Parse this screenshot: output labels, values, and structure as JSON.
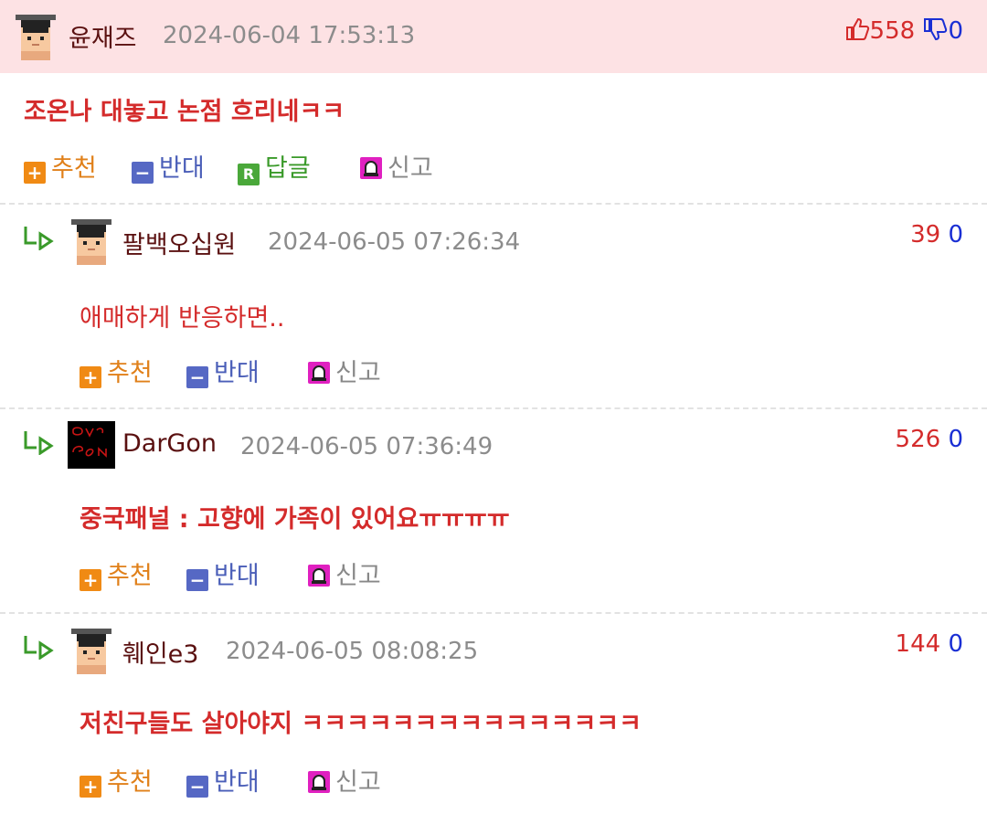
{
  "comments": [
    {
      "author": "윤재즈",
      "date": "2024-06-04 17:53:13",
      "up": "558",
      "down": "0",
      "content": "조온나 대놓고 논점 흐리네ㅋㅋ",
      "actions": {
        "recommend": "추천",
        "oppose": "반대",
        "reply": "답글",
        "report": "신고"
      }
    },
    {
      "author": "팔백오십원",
      "date": "2024-06-05 07:26:34",
      "up": "39",
      "down": "0",
      "content": "애매하게 반응하면..",
      "actions": {
        "recommend": "추천",
        "oppose": "반대",
        "report": "신고"
      }
    },
    {
      "author": "DarGon",
      "date": "2024-06-05 07:36:49",
      "up": "526",
      "down": "0",
      "content": "중국패널 : 고향에 가족이 있어요ㅠㅠㅠㅠ",
      "actions": {
        "recommend": "추천",
        "oppose": "반대",
        "report": "신고"
      }
    },
    {
      "author": "훼인e3",
      "date": "2024-06-05 08:08:25",
      "up": "144",
      "down": "0",
      "content": "저친구들도 살아야지 ㅋㅋㅋㅋㅋㅋㅋㅋㅋㅋㅋㅋㅋㅋㅋ",
      "actions": {
        "recommend": "추천",
        "oppose": "반대",
        "report": "신고"
      }
    }
  ],
  "colors": {
    "highlight_bg": "#fde2e4",
    "upvote": "#d42b2b",
    "downvote": "#1a2fd4",
    "recommend": "#f08a14",
    "oppose": "#5668c4",
    "reply": "#4aa83a",
    "report": "#e020c0"
  },
  "icons": {
    "avatar_default": "student-cap-avatar",
    "avatar_dargon": "dargon-avatar",
    "reply_marker": "reply-arrow-icon",
    "thumbs_up": "thumbs-up-icon",
    "thumbs_down": "thumbs-down-icon"
  }
}
